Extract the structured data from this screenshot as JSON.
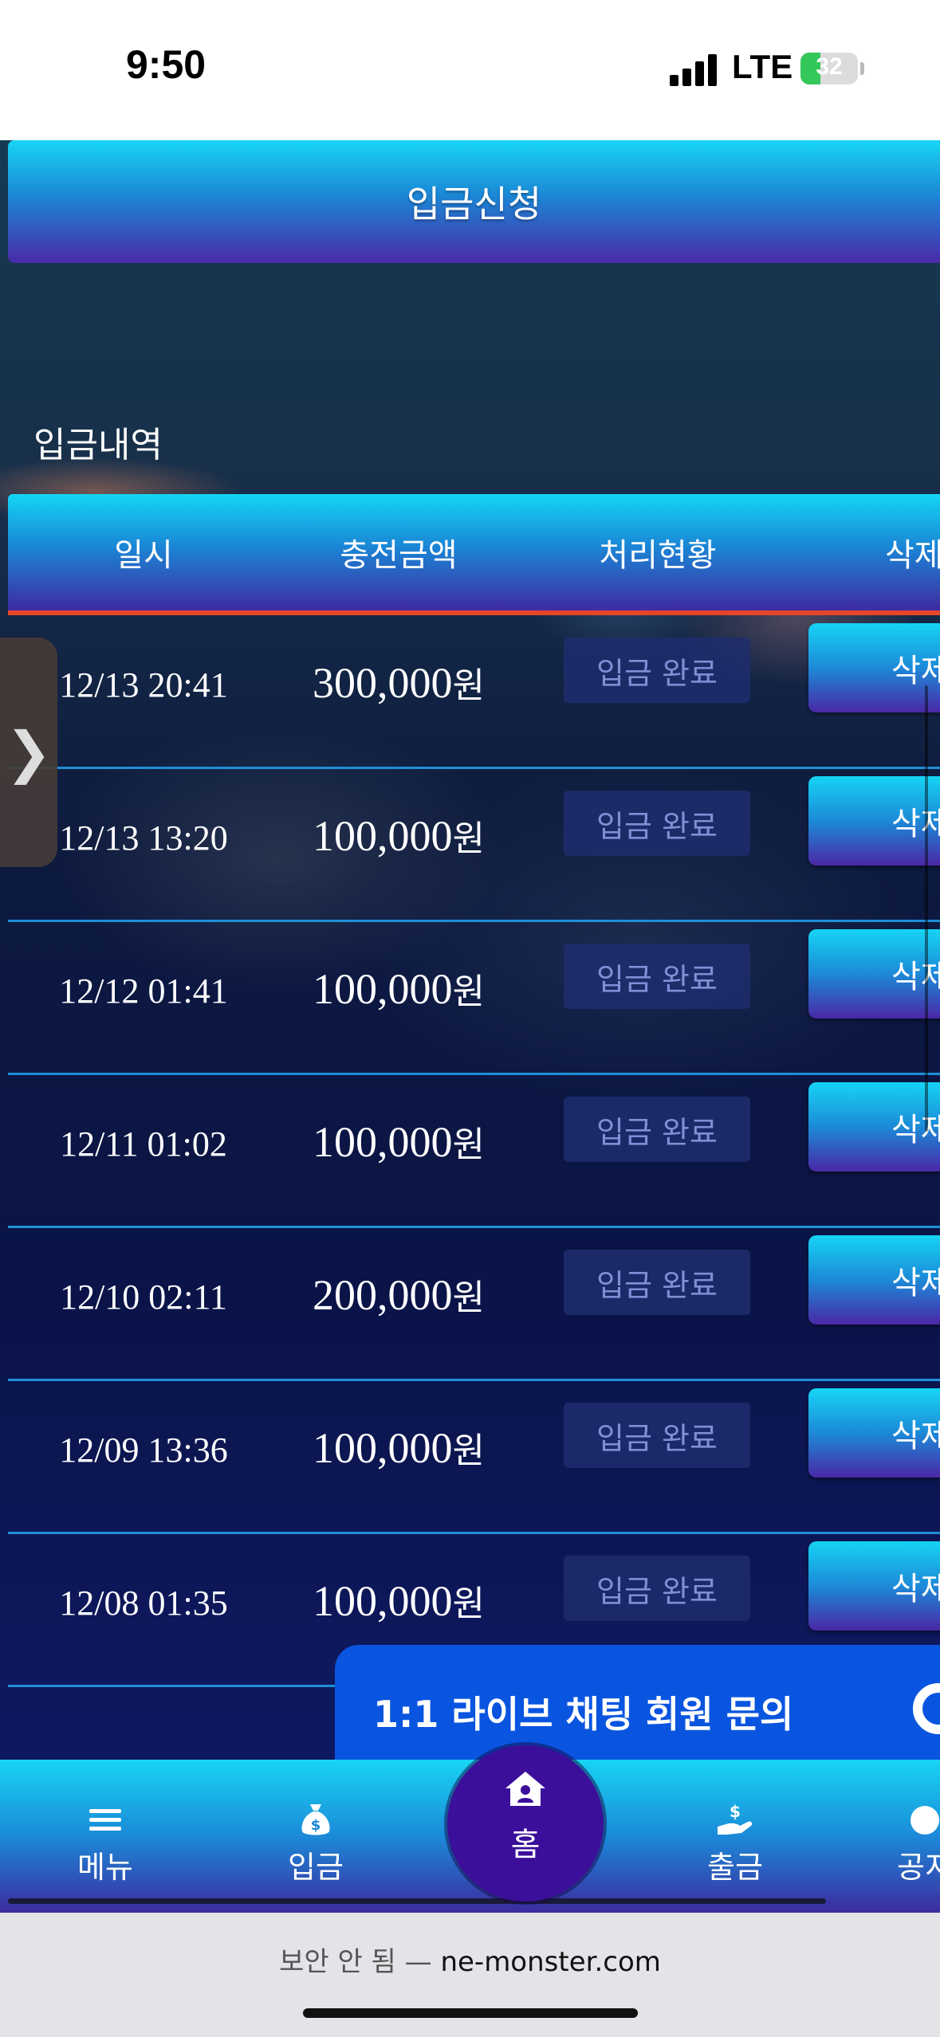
{
  "status_bar": {
    "time": "9:50",
    "network": "LTE",
    "battery": "32"
  },
  "header": {
    "title": "입금신청"
  },
  "section": {
    "title": "입금내역"
  },
  "table": {
    "columns": [
      "일시",
      "충전금액",
      "처리현황",
      "삭제"
    ],
    "rows": [
      {
        "date": "12/13 20:41",
        "amount": "300,000",
        "unit": "원",
        "status": "입금 완료",
        "action": "삭제"
      },
      {
        "date": "12/13 13:20",
        "amount": "100,000",
        "unit": "원",
        "status": "입금 완료",
        "action": "삭제"
      },
      {
        "date": "12/12 01:41",
        "amount": "100,000",
        "unit": "원",
        "status": "입금 완료",
        "action": "삭제"
      },
      {
        "date": "12/11 01:02",
        "amount": "100,000",
        "unit": "원",
        "status": "입금 완료",
        "action": "삭제"
      },
      {
        "date": "12/10 02:11",
        "amount": "200,000",
        "unit": "원",
        "status": "입금 완료",
        "action": "삭제"
      },
      {
        "date": "12/09 13:36",
        "amount": "100,000",
        "unit": "원",
        "status": "입금 완료",
        "action": "삭제"
      },
      {
        "date": "12/08 01:35",
        "amount": "100,000",
        "unit": "원",
        "status": "입금 완료",
        "action": "삭제"
      }
    ]
  },
  "chat_banner": {
    "label": "1:1 라이브 채팅 회원 문의"
  },
  "bottom_nav": {
    "items": [
      {
        "label": "메뉴",
        "icon": "hamburger-icon"
      },
      {
        "label": "입금",
        "icon": "money-bag-icon"
      },
      {
        "label": "홈",
        "icon": "home-icon"
      },
      {
        "label": "출금",
        "icon": "hand-coin-icon"
      },
      {
        "label": "공지",
        "icon": "notice-icon"
      }
    ]
  },
  "browser": {
    "security": "보안 안 됨",
    "separator": "—",
    "domain": "ne-monster.com"
  },
  "colors": {
    "accent_cyan": "#16d4f4",
    "accent_purple": "#4a27a6",
    "divider_red": "#e7452a",
    "chat_blue": "#0a55e0"
  }
}
